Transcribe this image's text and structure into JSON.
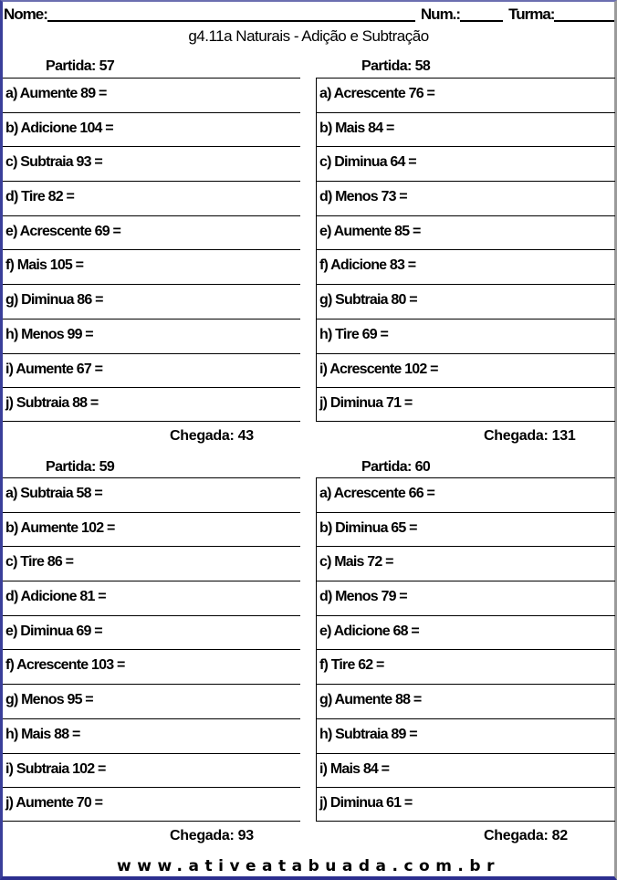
{
  "header": {
    "name_label": "Nome:",
    "num_label": "Num.:",
    "turma_label": "Turma:"
  },
  "title": "g4.11a Naturais - Adição e Subtração",
  "exercises": [
    {
      "partida": "Partida: 57",
      "items": [
        "a) Aumente 89 =",
        "b) Adicione 104 =",
        "c) Subtraia 93 =",
        "d) Tire 82 =",
        "e) Acrescente 69 =",
        "f) Mais 105 =",
        "g) Diminua 86 =",
        "h) Menos 99 =",
        "i) Aumente 67 =",
        "j) Subtraia 88 ="
      ],
      "chegada": "Chegada: 43"
    },
    {
      "partida": "Partida: 58",
      "items": [
        "a) Acrescente 76 =",
        "b) Mais 84 =",
        "c) Diminua 64 =",
        "d) Menos 73 =",
        "e) Aumente 85 =",
        "f) Adicione 83 =",
        "g) Subtraia 80 =",
        "h) Tire 69 =",
        "i) Acrescente 102 =",
        "j) Diminua 71 ="
      ],
      "chegada": "Chegada: 131"
    },
    {
      "partida": "Partida: 59",
      "items": [
        "a) Subtraia 58 =",
        "b) Aumente 102 =",
        "c) Tire 86 =",
        "d) Adicione 81 =",
        "e) Diminua 69 =",
        "f) Acrescente 103 =",
        "g) Menos 95 =",
        "h) Mais 88 =",
        "i) Subtraia 102 =",
        "j) Aumente 70 ="
      ],
      "chegada": "Chegada: 93"
    },
    {
      "partida": "Partida: 60",
      "items": [
        "a) Acrescente 66 =",
        "b) Diminua 65 =",
        "c) Mais 72 =",
        "d) Menos 79 =",
        "e) Adicione 68 =",
        "f) Tire 62 =",
        "g) Aumente 88 =",
        "h) Subtraia 89 =",
        "i) Mais 84 =",
        "j) Diminua 61 ="
      ],
      "chegada": "Chegada: 82"
    }
  ],
  "footer": "www.ativeatabuada.com.br"
}
